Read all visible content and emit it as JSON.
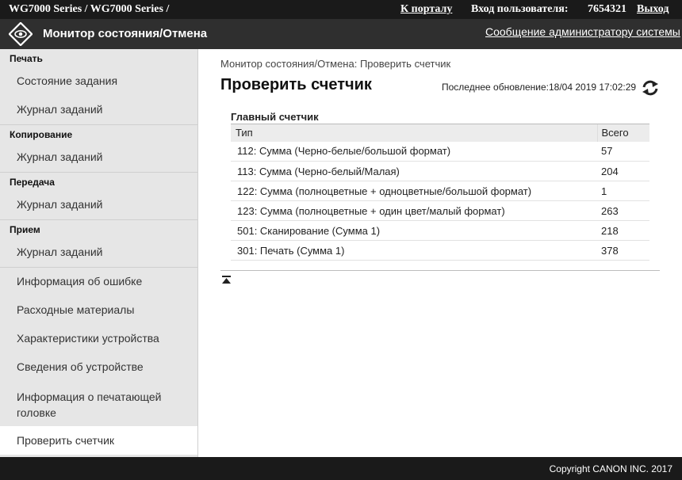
{
  "top_bar": {
    "device_name": "WG7000 Series / WG7000 Series /",
    "portal_link": "К порталу",
    "login_label": "Вход пользователя:",
    "user_id": "7654321",
    "logout_link": "Выход"
  },
  "header": {
    "title": "Монитор состояния/Отмена",
    "admin_message_link": "Сообщение администратору системы"
  },
  "sidebar": {
    "sections": [
      {
        "label": "Печать",
        "items": [
          "Состояние задания",
          "Журнал заданий"
        ]
      },
      {
        "label": "Копирование",
        "items": [
          "Журнал заданий"
        ]
      },
      {
        "label": "Передача",
        "items": [
          "Журнал заданий"
        ]
      },
      {
        "label": "Прием",
        "items": [
          "Журнал заданий"
        ]
      }
    ],
    "other_items": [
      "Информация об ошибке",
      "Расходные материалы",
      "Характеристики устройства",
      "Сведения об устройстве",
      "Информация о печатающей головке",
      "Проверить счетчик"
    ],
    "active_item": "Проверить счетчик"
  },
  "main": {
    "breadcrumb": "Монитор состояния/Отмена: Проверить счетчик",
    "title": "Проверить счетчик",
    "last_update": "Последнее обновление:18/04 2019 17:02:29",
    "counter_title": "Главный счетчик",
    "columns": [
      "Тип",
      "Всего"
    ],
    "rows": [
      {
        "type": "112: Сумма (Черно-белые/большой формат)",
        "total": "57"
      },
      {
        "type": "113: Сумма (Черно-белый/Малая)",
        "total": "204"
      },
      {
        "type": "122: Сумма (полноцветные + одноцветные/большой формат)",
        "total": "1"
      },
      {
        "type": "123: Сумма (полноцветные + один цвет/малый формат)",
        "total": "263"
      },
      {
        "type": "501: Сканирование (Сумма 1)",
        "total": "218"
      },
      {
        "type": "301: Печать (Сумма 1)",
        "total": "378"
      }
    ]
  },
  "footer": {
    "copyright": "Copyright CANON INC. 2017"
  },
  "icons": {
    "logo": "canon-eye-logo-icon",
    "refresh": "refresh-icon",
    "back_to_top": "back-to-top-icon"
  },
  "colors": {
    "top_bar": "#1a1a1a",
    "header_bar": "#2f2f2f",
    "sidebar": "#e6e6e6",
    "table_header": "#ececec"
  }
}
